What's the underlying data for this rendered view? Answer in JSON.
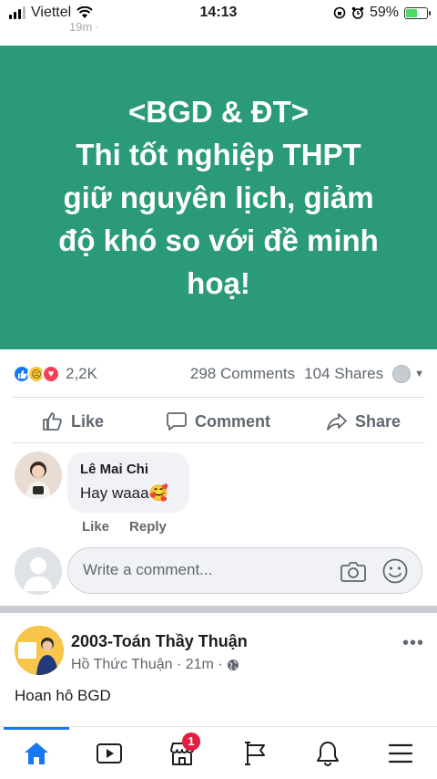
{
  "status_bar": {
    "carrier": "Viettel",
    "time": "14:13",
    "battery_percent": "59%",
    "battery_level": 0.59,
    "previous_post_time": "19m · "
  },
  "banner": {
    "background_color": "#2b9a78",
    "text": "<BGD & ĐT>\nThi tốt nghiệp THPT\ngiữ nguyên lịch, giảm\nđộ khó so với đề minh\nhoạ!"
  },
  "reactions": {
    "icons": [
      "like-icon",
      "sad-icon",
      "love-icon"
    ],
    "count": "2,2K",
    "comments": "298 Comments",
    "shares": "104 Shares"
  },
  "actions": {
    "like": "Like",
    "comment": "Comment",
    "share": "Share"
  },
  "comment": {
    "author": "Lê Mai Chi",
    "text": "Hay waaa🥰",
    "like_label": "Like",
    "reply_label": "Reply"
  },
  "write_comment": {
    "placeholder": "Write a comment..."
  },
  "next_post": {
    "author": "2003-Toán Thầy Thuận",
    "meta": "Hồ Thức Thuận · 21m ·",
    "text": "Hoan hô BGD"
  },
  "bottom_nav": {
    "items": [
      "home-icon",
      "watch-icon",
      "marketplace-icon",
      "pages-icon",
      "notifications-icon",
      "menu-icon"
    ],
    "marketplace_badge": "1",
    "accent_color": "#1877f2"
  }
}
